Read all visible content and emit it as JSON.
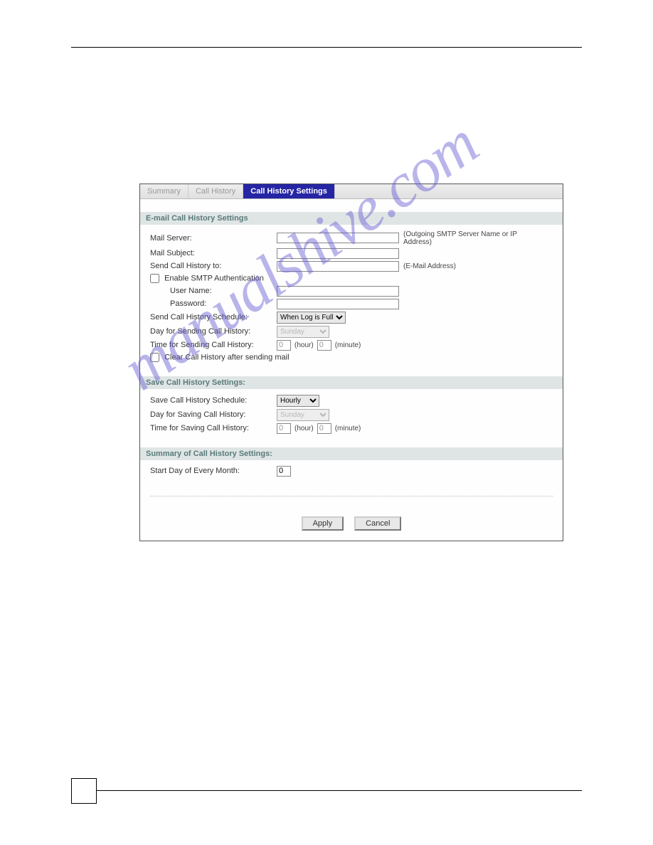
{
  "tabs": {
    "summary": "Summary",
    "call_history": "Call History",
    "call_history_settings": "Call History Settings"
  },
  "email_section": {
    "header": "E-mail Call History Settings",
    "mail_server_label": "Mail Server:",
    "mail_server_hint": "(Outgoing SMTP Server Name or IP Address)",
    "mail_subject_label": "Mail Subject:",
    "send_to_label": "Send Call History to:",
    "send_to_hint": "(E-Mail Address)",
    "enable_smtp_label": "Enable SMTP Authentication",
    "user_name_label": "User Name:",
    "password_label": "Password:",
    "schedule_label": "Send Call History Schedule:",
    "schedule_value": "When Log is Full",
    "day_label": "Day for Sending Call History:",
    "day_value": "Sunday",
    "time_label": "Time for Sending Call History:",
    "time_hour": "0",
    "hour_text": "(hour)",
    "time_minute": "0",
    "minute_text": "(minute)",
    "clear_label": "Clear Call History after sending mail"
  },
  "save_section": {
    "header": "Save Call History Settings:",
    "schedule_label": "Save Call History Schedule:",
    "schedule_value": "Hourly",
    "day_label": "Day for Saving Call History:",
    "day_value": "Sunday",
    "time_label": "Time for Saving Call History:",
    "time_hour": "0",
    "hour_text": "(hour)",
    "time_minute": "0",
    "minute_text": "(minute)"
  },
  "summary_section": {
    "header": "Summary of Call History Settings:",
    "start_day_label": "Start Day of Every Month:",
    "start_day_value": "0"
  },
  "buttons": {
    "apply": "Apply",
    "cancel": "Cancel"
  },
  "watermark": "manualshive.com"
}
